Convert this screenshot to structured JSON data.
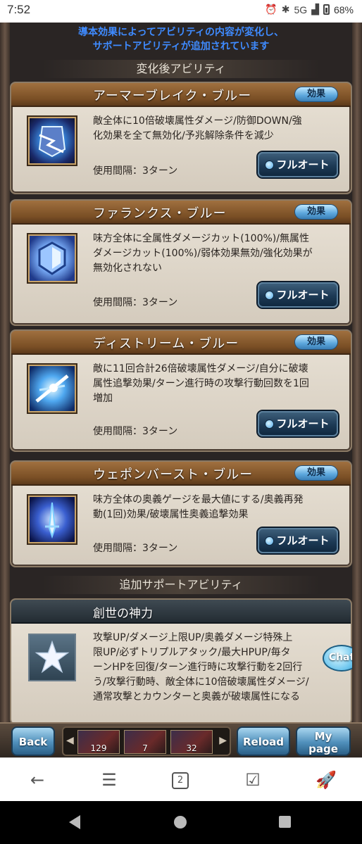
{
  "status_bar": {
    "time": "7:52",
    "network": "5G",
    "battery": "68%"
  },
  "notice": {
    "line1": "導本効果によってアビリティの内容が変化し、",
    "line2": "サポートアビリティが追加されています"
  },
  "sections": {
    "changed_title": "変化後アビリティ",
    "support_title": "追加サポートアビリティ"
  },
  "abilities": [
    {
      "name": "アーマーブレイク・ブルー",
      "effect_label": "効果",
      "icon": "shield-break-icon",
      "desc_lines": [
        "敵全体に10倍破壊属性ダメージ/防御DOWN/強",
        "化効果を全て無効化/予兆解除条件を減少"
      ],
      "interval": "使用間隔：3ターン",
      "button": "フルオート"
    },
    {
      "name": "ファランクス・ブルー",
      "effect_label": "効果",
      "icon": "phalanx-shield-icon",
      "desc_lines": [
        "味方全体に全属性ダメージカット(100%)/無属性",
        "ダメージカット(100%)/弱体効果無効/強化効果が",
        "無効化されない"
      ],
      "interval": "使用間隔：3ターン",
      "button": "フルオート"
    },
    {
      "name": "ディストリーム・ブルー",
      "effect_label": "効果",
      "icon": "slash-attack-icon",
      "desc_lines": [
        "敵に11回合計26倍破壊属性ダメージ/自分に破壊",
        "属性追撃効果/ターン進行時の攻撃行動回数を1回",
        "増加"
      ],
      "interval": "使用間隔：3ターン",
      "button": "フルオート"
    },
    {
      "name": "ウェポンバースト・ブルー",
      "effect_label": "効果",
      "icon": "weapon-burst-icon",
      "desc_lines": [
        "味方全体の奥義ゲージを最大値にする/奥義再発",
        "動(1回)効果/破壊属性奥義追撃効果"
      ],
      "interval": "使用間隔：3ターン",
      "button": "フルオート"
    }
  ],
  "support": {
    "name": "創世の神力",
    "icon": "star-icon",
    "desc_lines": [
      "攻撃UP/ダメージ上限UP/奥義ダメージ特殊上",
      "限UP/必ずトリプルアタック/最大HPUP/毎タ",
      "ーンHPを回復/ターン進行時に攻撃行動を2回行",
      "う/攻撃行動時、敵全体に10倍破壊属性ダメージ/",
      "通常攻撃とカウンターと奥義が破壊属性になる"
    ]
  },
  "chat_label": "Chat",
  "game_bar": {
    "back": "Back",
    "reload": "Reload",
    "mypage_line1": "My",
    "mypage_line2": "page",
    "items": [
      "129",
      "7",
      "32"
    ]
  },
  "browser": {
    "tab_count": "2"
  }
}
